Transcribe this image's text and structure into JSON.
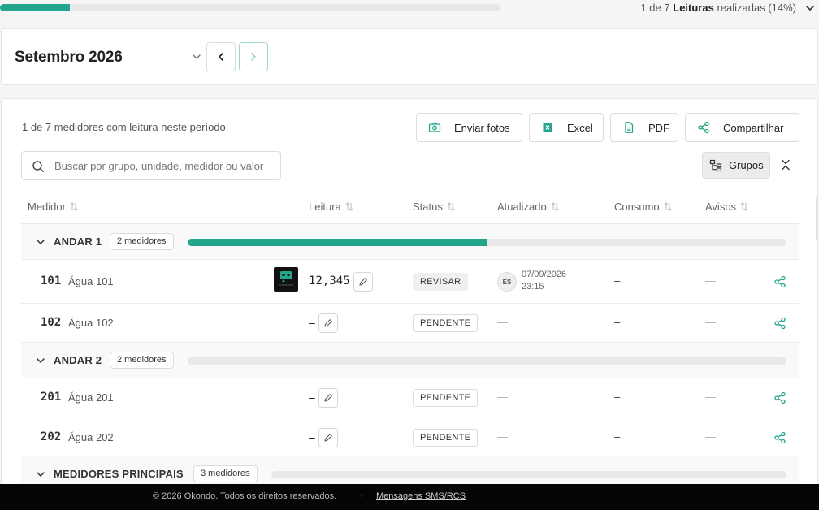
{
  "progress": {
    "fraction": 0.14,
    "summary_prefix": "1 de 7",
    "summary_bold": "Leituras",
    "summary_suffix": "realizadas (14%)"
  },
  "period": {
    "title": "Setembro 2026"
  },
  "main": {
    "count_text": "1 de 7 medidores com leitura neste período",
    "actions": {
      "fotos": "Enviar fotos",
      "excel": "Excel",
      "pdf": "PDF",
      "share": "Compartilhar"
    },
    "search_placeholder": "Buscar por grupo, unidade, medidor ou valor",
    "groups_label": "Grupos"
  },
  "table": {
    "headers": {
      "medidor": "Medidor",
      "leitura": "Leitura",
      "status": "Status",
      "atualizado": "Atualizado",
      "consumo": "Consumo",
      "avisos": "Avisos"
    },
    "groups": [
      {
        "name": "ANDAR 1",
        "badge": "2 medidores",
        "fraction": 0.5
      },
      {
        "name": "ANDAR 2",
        "badge": "2 medidores",
        "fraction": 0
      },
      {
        "name": "MEDIDORES PRINCIPAIS",
        "badge": "3 medidores",
        "fraction": 0
      }
    ],
    "rows": [
      {
        "code": "101",
        "name": "Água 101",
        "value": "12,345",
        "status": "REVISAR",
        "avatar": "ES",
        "updated_date": "07/09/2026",
        "updated_time": "23:15",
        "consumo": "–",
        "avisos": "—"
      },
      {
        "code": "102",
        "name": "Água 102",
        "value": "–",
        "status": "PENDENTE",
        "updated": "—",
        "consumo": "–",
        "avisos": "—"
      },
      {
        "code": "201",
        "name": "Água 201",
        "value": "–",
        "status": "PENDENTE",
        "updated": "—",
        "consumo": "–",
        "avisos": "—"
      },
      {
        "code": "202",
        "name": "Água 202",
        "value": "–",
        "status": "PENDENTE",
        "updated": "—",
        "consumo": "–",
        "avisos": "—"
      }
    ]
  },
  "footer": {
    "copyright": "© 2026 Okondo. Todos os direitos reservados.",
    "separator": "·",
    "link": "Mensagens SMS/RCS"
  },
  "colors": {
    "accent": "#22a58a",
    "footer_bg": "#050505"
  }
}
